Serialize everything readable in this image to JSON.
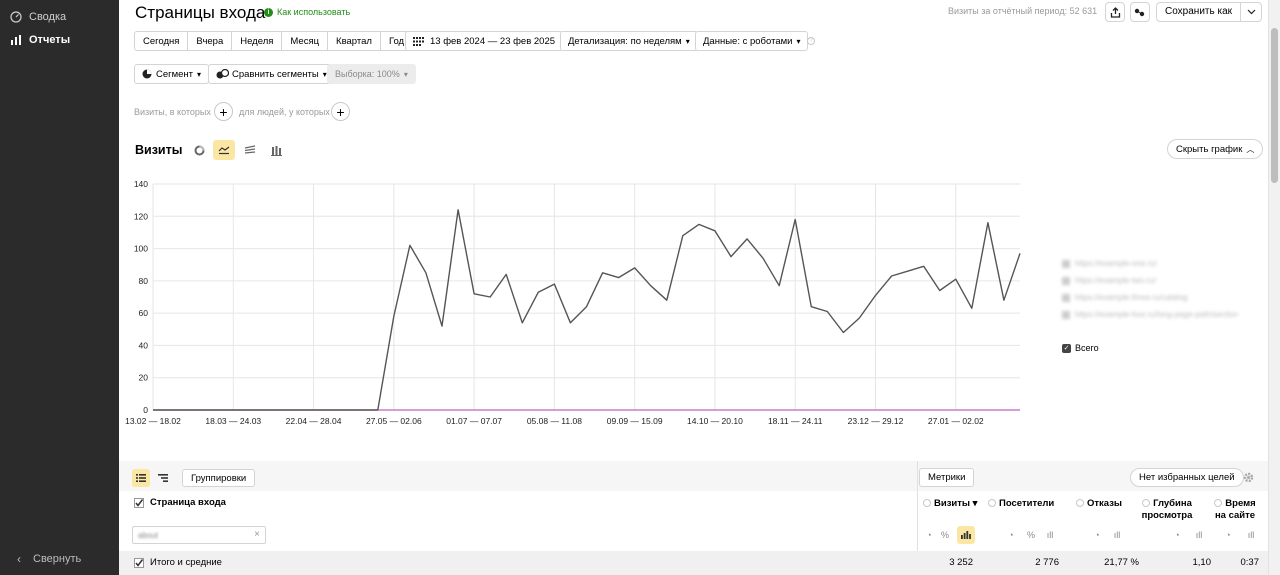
{
  "sidebar": {
    "items": [
      {
        "label": "Сводка",
        "icon": "gauge-icon"
      },
      {
        "label": "Отчеты",
        "icon": "bar-chart-icon"
      }
    ],
    "collapse_label": "Свернуть"
  },
  "header": {
    "title": "Страницы входа",
    "howto": "Как использовать",
    "period_stat": "Визиты за отчётный период: 52 631",
    "save_as": "Сохранить как"
  },
  "period_buttons": [
    "Сегодня",
    "Вчера",
    "Неделя",
    "Месяц",
    "Квартал",
    "Год"
  ],
  "date_range": "13 фев 2024 — 23 фев 2025",
  "detail": "Детализация: по неделям",
  "data_mode": "Данные: с роботами",
  "segment": "Сегмент",
  "compare": "Сравнить сегменты",
  "sample": "Выборка: 100%",
  "filters": {
    "visits": "Визиты, в которых",
    "people": "для людей, у которых"
  },
  "chart_header": {
    "title": "Визиты",
    "hide_label": "Скрыть график"
  },
  "legend_total": "Всего",
  "chart_data": {
    "type": "line",
    "xlabel": "",
    "ylabel": "",
    "ylim": [
      0,
      140
    ],
    "yticks": [
      0,
      20,
      40,
      60,
      80,
      100,
      120,
      140
    ],
    "xtick_labels": [
      "13.02 — 18.02",
      "18.03 — 24.03",
      "22.04 — 28.04",
      "27.05 — 02.06",
      "01.07 — 07.07",
      "05.08 — 11.08",
      "09.09 — 15.09",
      "14.10 — 20.10",
      "18.11 — 24.11",
      "23.12 — 29.12",
      "27.01 — 02.02"
    ],
    "xtick_index": [
      0,
      5,
      10,
      15,
      20,
      25,
      30,
      35,
      40,
      45,
      50
    ],
    "grid": true,
    "series": [
      {
        "name": "Всего",
        "color": "#555555",
        "values": [
          0,
          0,
          0,
          0,
          0,
          0,
          0,
          0,
          0,
          0,
          0,
          0,
          0,
          0,
          0,
          58,
          102,
          85,
          52,
          124,
          72,
          70,
          84,
          54,
          73,
          78,
          54,
          64,
          85,
          82,
          88,
          77,
          68,
          108,
          115,
          111,
          95,
          106,
          94,
          77,
          118,
          64,
          61,
          48,
          57,
          71,
          83,
          86,
          89,
          74,
          81,
          63,
          116,
          68,
          97
        ]
      },
      {
        "name": "",
        "color": "#c060c0",
        "values": [
          0,
          0,
          0,
          0,
          0,
          0,
          0,
          0,
          0,
          0,
          0,
          0,
          0,
          0,
          0,
          0,
          0,
          0,
          0,
          0,
          0,
          0,
          0,
          0,
          0,
          0,
          0,
          0,
          0,
          0,
          0,
          0,
          0,
          0,
          0,
          0,
          0,
          0,
          0,
          0,
          0,
          0,
          0,
          0,
          0,
          0,
          0,
          0,
          0,
          0,
          0,
          0,
          0,
          0,
          0
        ]
      }
    ]
  },
  "table": {
    "group_label": "Группировки",
    "metrics_label": "Метрики",
    "goals_label": "Нет избранных целей",
    "dimension_header": "Страница входа",
    "columns": [
      "Визиты",
      "Посетители",
      "Отказы",
      "Глубина просмотра",
      "Время на сайте"
    ],
    "totals_label": "Итого и средние",
    "totals": [
      "3 252",
      "2 776",
      "21,77 %",
      "1,10",
      "0:37"
    ]
  }
}
